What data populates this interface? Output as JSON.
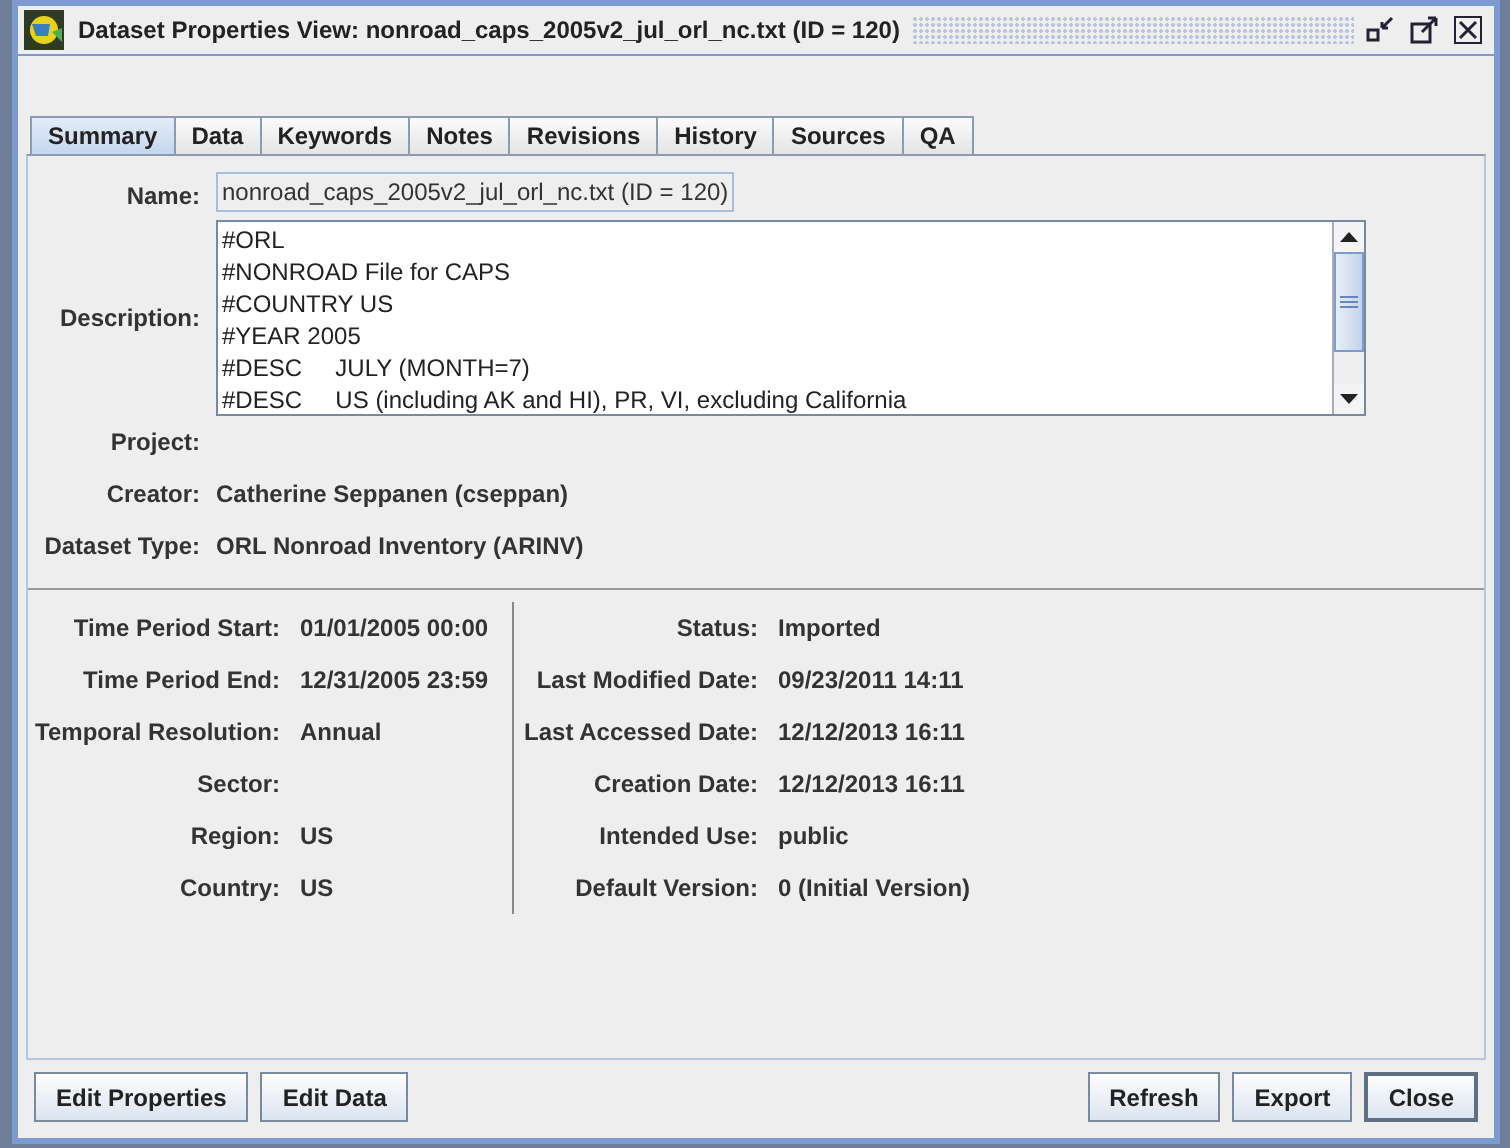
{
  "window": {
    "title": "Dataset Properties View: nonroad_caps_2005v2_jul_orl_nc.txt (ID = 120)"
  },
  "tabs": [
    {
      "label": "Summary",
      "selected": true
    },
    {
      "label": "Data",
      "selected": false
    },
    {
      "label": "Keywords",
      "selected": false
    },
    {
      "label": "Notes",
      "selected": false
    },
    {
      "label": "Revisions",
      "selected": false
    },
    {
      "label": "History",
      "selected": false
    },
    {
      "label": "Sources",
      "selected": false
    },
    {
      "label": "QA",
      "selected": false
    }
  ],
  "summary": {
    "name_label": "Name:",
    "name_value": "nonroad_caps_2005v2_jul_orl_nc.txt (ID = 120)",
    "description_label": "Description:",
    "description_lines": [
      "#ORL",
      "#NONROAD File for CAPS",
      "#COUNTRY US",
      "#YEAR 2005",
      "#DESC     JULY (MONTH=7)",
      "#DESC     US (including AK and HI), PR, VI, excluding California"
    ],
    "fields": [
      {
        "label": "Project:"
      },
      {
        "label": "Creator:",
        "value": "Catherine Seppanen (cseppan)"
      },
      {
        "label": "Dataset Type:",
        "value": "ORL Nonroad Inventory (ARINV)"
      }
    ]
  },
  "details_left": [
    {
      "label": "Time Period Start:",
      "value": "01/01/2005 00:00"
    },
    {
      "label": "Time Period End:",
      "value": "12/31/2005 23:59"
    },
    {
      "label": "Temporal Resolution:",
      "value": "Annual"
    },
    {
      "label": "Sector:"
    },
    {
      "label": "Region:",
      "value": "US"
    },
    {
      "label": "Country:",
      "value": "US"
    }
  ],
  "details_right": [
    {
      "label": "Status:",
      "value": "Imported"
    },
    {
      "label": "Last Modified Date:",
      "value": "09/23/2011 14:11"
    },
    {
      "label": "Last Accessed Date:",
      "value": "12/12/2013 16:11"
    },
    {
      "label": "Creation Date:",
      "value": "12/12/2013 16:11"
    },
    {
      "label": "Intended Use:",
      "value": "public"
    },
    {
      "label": "Default Version:",
      "value": "0 (Initial Version)"
    }
  ],
  "buttons_left": [
    "Edit Properties",
    "Edit Data"
  ],
  "buttons_right": [
    {
      "label": "Refresh",
      "focused": false
    },
    {
      "label": "Export",
      "focused": false
    },
    {
      "label": "Close",
      "focused": true
    }
  ]
}
